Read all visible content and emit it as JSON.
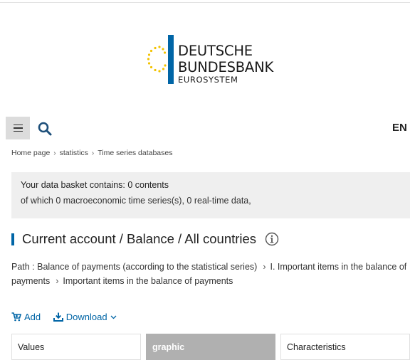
{
  "logo": {
    "line1": "DEUTSCHE",
    "line2": "BUNDESBANK",
    "line3": "EUROSYSTEM",
    "bar_color": "#0065a6",
    "star_color": "#f2c200"
  },
  "header": {
    "menu_icon": "hamburger-icon",
    "search_icon": "search-icon",
    "language": "EN"
  },
  "breadcrumb": [
    "Home page",
    "statistics",
    "Time series databases"
  ],
  "basket": {
    "line1": "Your data basket contains: 0 contents",
    "line2": "of which 0 macroeconomic time series(s), 0 real-time data,"
  },
  "page": {
    "title": "Current account / Balance / All countries",
    "info_icon": "info-circle-icon"
  },
  "path": {
    "prefix": "Path : Balance of payments (according to the statistical series)",
    "item1": "I. Important items in the balance of payments",
    "item2": "Important items in the balance of payments"
  },
  "actions": {
    "add": "Add",
    "download": "Download",
    "accent_color": "#0065a6"
  },
  "tabs": [
    {
      "label": "Values",
      "active": false
    },
    {
      "label": "graphic",
      "active": true
    },
    {
      "label": "Characteristics",
      "active": false
    }
  ]
}
